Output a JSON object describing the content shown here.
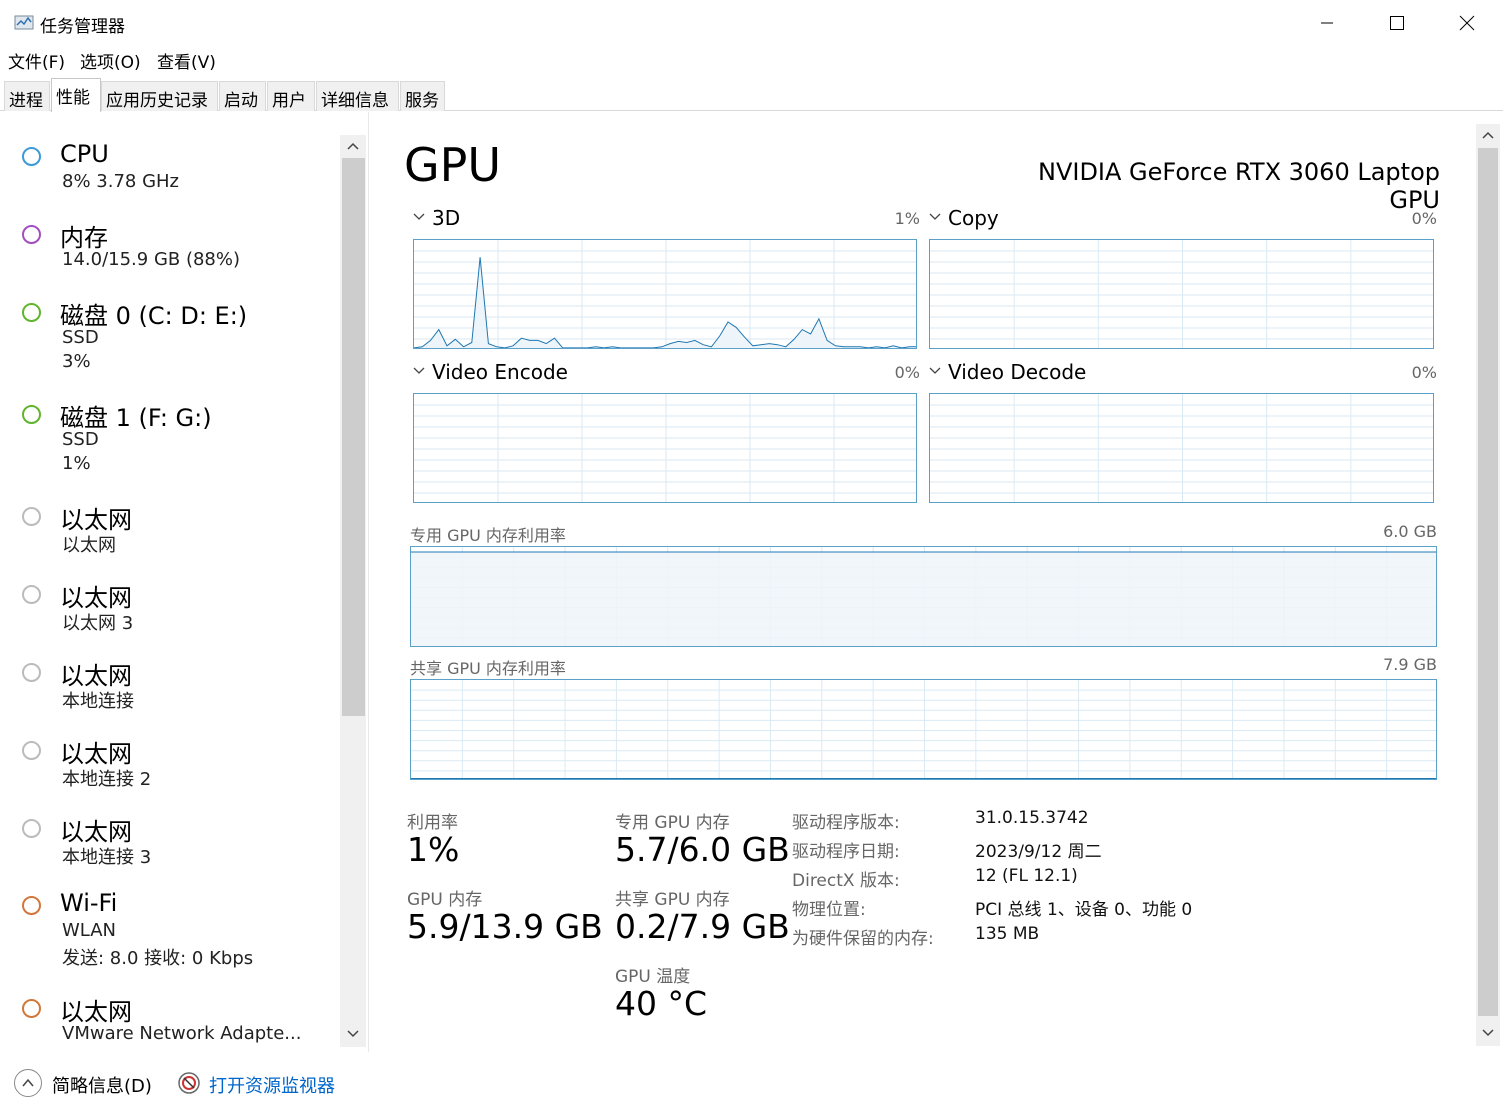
{
  "window": {
    "title": "任务管理器"
  },
  "menu": [
    "文件(F)",
    "选项(O)",
    "查看(V)"
  ],
  "tabs": [
    "进程",
    "性能",
    "应用历史记录",
    "启动",
    "用户",
    "详细信息",
    "服务"
  ],
  "active_tab": "性能",
  "sidebar": {
    "items": [
      {
        "name": "CPU",
        "line1": "8%  3.78 GHz",
        "line2": "",
        "dot_color": "#3c9ad8"
      },
      {
        "name": "内存",
        "line1": "14.0/15.9 GB (88%)",
        "line2": "",
        "dot_color": "#a34ec0"
      },
      {
        "name": "磁盘 0 (C: D: E:)",
        "line1": "SSD",
        "line2": "3%",
        "dot_color": "#5fb52c"
      },
      {
        "name": "磁盘 1 (F: G:)",
        "line1": "SSD",
        "line2": "1%",
        "dot_color": "#5fb52c"
      },
      {
        "name": "以太网",
        "line1": "以太网",
        "line2": "",
        "dot_color": "#bbbbbb"
      },
      {
        "name": "以太网",
        "line1": "以太网 3",
        "line2": "",
        "dot_color": "#bbbbbb"
      },
      {
        "name": "以太网",
        "line1": "本地连接",
        "line2": "",
        "dot_color": "#bbbbbb"
      },
      {
        "name": "以太网",
        "line1": "本地连接 2",
        "line2": "",
        "dot_color": "#bbbbbb"
      },
      {
        "name": "以太网",
        "line1": "本地连接 3",
        "line2": "",
        "dot_color": "#bbbbbb"
      },
      {
        "name": "Wi-Fi",
        "line1": "WLAN",
        "line2": "发送: 8.0  接收: 0 Kbps",
        "dot_color": "#d2773a"
      },
      {
        "name": "以太网",
        "line1": "VMware Network Adapte...",
        "line2": "",
        "dot_color": "#d2773a"
      }
    ]
  },
  "main": {
    "title": "GPU",
    "device": "NVIDIA GeForce RTX 3060 Laptop GPU",
    "engines": [
      {
        "name": "3D",
        "pct": "1%"
      },
      {
        "name": "Copy",
        "pct": "0%"
      },
      {
        "name": "Video Encode",
        "pct": "0%"
      },
      {
        "name": "Video Decode",
        "pct": "0%"
      }
    ],
    "engine_3d_series": [
      1,
      2,
      8,
      18,
      3,
      9,
      2,
      6,
      85,
      5,
      2,
      1,
      3,
      10,
      8,
      8,
      5,
      10,
      1,
      1,
      1,
      1,
      2,
      1,
      2,
      1,
      1,
      1,
      1,
      1,
      2,
      5,
      7,
      6,
      8,
      4,
      2,
      12,
      25,
      20,
      11,
      3,
      4,
      5,
      4,
      2,
      9,
      18,
      14,
      28,
      8,
      3,
      2,
      2,
      2,
      1,
      2,
      1,
      3,
      1,
      2,
      2
    ],
    "dedicated_mem": {
      "label": "专用 GPU 内存利用率",
      "max": "6.0 GB",
      "used_fraction": 0.95
    },
    "shared_mem": {
      "label": "共享 GPU 内存利用率",
      "max": "7.9 GB",
      "used_fraction": 0.025
    },
    "stats": {
      "utilization_label": "利用率",
      "utilization": "1%",
      "gpu_mem_label": "GPU 内存",
      "gpu_mem": "5.9/13.9 GB",
      "dedicated_label": "专用 GPU 内存",
      "dedicated": "5.7/6.0 GB",
      "shared_label": "共享 GPU 内存",
      "shared": "0.2/7.9 GB",
      "temp_label": "GPU 温度",
      "temp": "40 °C"
    },
    "info": [
      {
        "label": "驱动程序版本:",
        "value": "31.0.15.3742"
      },
      {
        "label": "驱动程序日期:",
        "value": "2023/9/12 周二"
      },
      {
        "label": "DirectX 版本:",
        "value": "12 (FL 12.1)"
      },
      {
        "label": "物理位置:",
        "value": "PCI 总线 1、设备 0、功能 0"
      },
      {
        "label": "为硬件保留的内存:",
        "value": "135 MB"
      }
    ]
  },
  "footer": {
    "brief": "简略信息(D)",
    "monitor": "打开资源监视器"
  },
  "colors": {
    "graph_border": "#5aa0c8",
    "graph_grid": "#d9eaf4",
    "graph_fill": "#eef5fa",
    "link": "#0066cc"
  }
}
